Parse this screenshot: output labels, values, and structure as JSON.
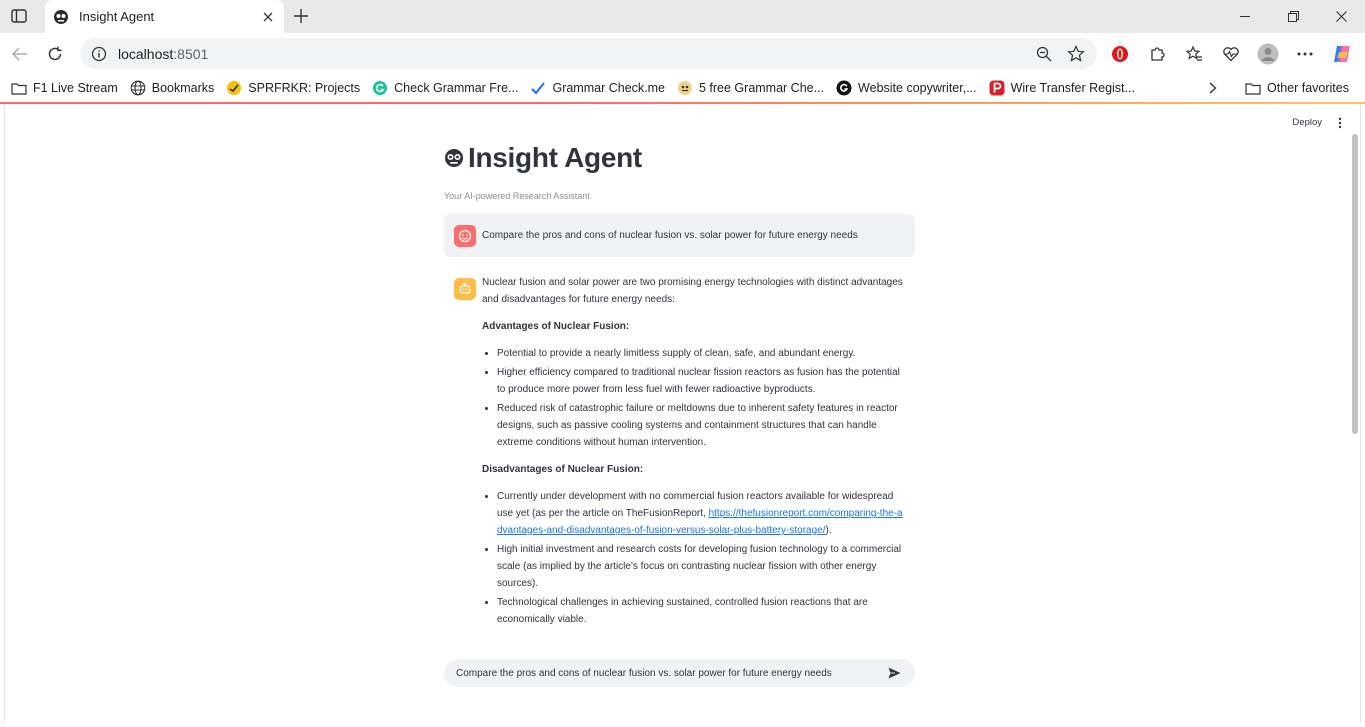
{
  "browser": {
    "tab_title": "Insight Agent",
    "url_host": "localhost",
    "url_port": ":8501",
    "bookmarks": [
      {
        "label": "F1 Live Stream",
        "icon": "folder-icon"
      },
      {
        "label": "Bookmarks",
        "icon": "globe-icon"
      },
      {
        "label": "SPRFRKR: Projects",
        "icon": "sprfrkr-icon"
      },
      {
        "label": "Check Grammar Fre...",
        "icon": "grammarly-icon"
      },
      {
        "label": "Grammar Check.me",
        "icon": "checkmark-icon"
      },
      {
        "label": "5 free Grammar Che...",
        "icon": "grammar-icon"
      },
      {
        "label": "Website copywriter,...",
        "icon": "g-icon"
      },
      {
        "label": "Wire Transfer Regist...",
        "icon": "p-icon"
      }
    ],
    "other_favorites": "Other favorites",
    "colors": {
      "tab_bg": "#e9e9e9",
      "accent_red": "#ff4b4b",
      "accent_yellow": "#ffbd45"
    }
  },
  "app": {
    "deploy_label": "Deploy",
    "title": "Insight Agent",
    "subtitle": "Your AI-powered Research Assistant",
    "user_message": "Compare the pros and cons of nuclear fusion vs. solar power for future energy needs",
    "assistant": {
      "intro": "Nuclear fusion and solar power are two promising energy technologies with distinct advantages and disadvantages for future energy needs:",
      "adv_heading": "Advantages of Nuclear Fusion:",
      "adv_items": [
        "Potential to provide a nearly limitless supply of clean, safe, and abundant energy.",
        "Higher efficiency compared to traditional nuclear fission reactors as fusion has the potential to produce more power from less fuel with fewer radioactive byproducts.",
        "Reduced risk of catastrophic failure or meltdowns due to inherent safety features in reactor designs, such as passive cooling systems and containment structures that can handle extreme conditions without human intervention."
      ],
      "disadv_heading": "Disadvantages of Nuclear Fusion:",
      "disadv_item1_prefix": "Currently under development with no commercial fusion reactors available for widespread use yet (as per the article on TheFusionReport, ",
      "disadv_item1_link": "https://thefusionreport.com/comparing-the-advantages-and-disadvantages-of-fusion-versus-solar-plus-battery-storage/",
      "disadv_item1_suffix": ").",
      "disadv_items_rest": [
        "High initial investment and research costs for developing fusion technology to a commercial scale (as implied by the article's focus on contrasting nuclear fission with other energy sources).",
        "Technological challenges in achieving sustained, controlled fusion reactions that are economically viable."
      ]
    },
    "chat_input_value": "Compare the pros and cons of nuclear fusion vs. solar power for future energy needs"
  }
}
